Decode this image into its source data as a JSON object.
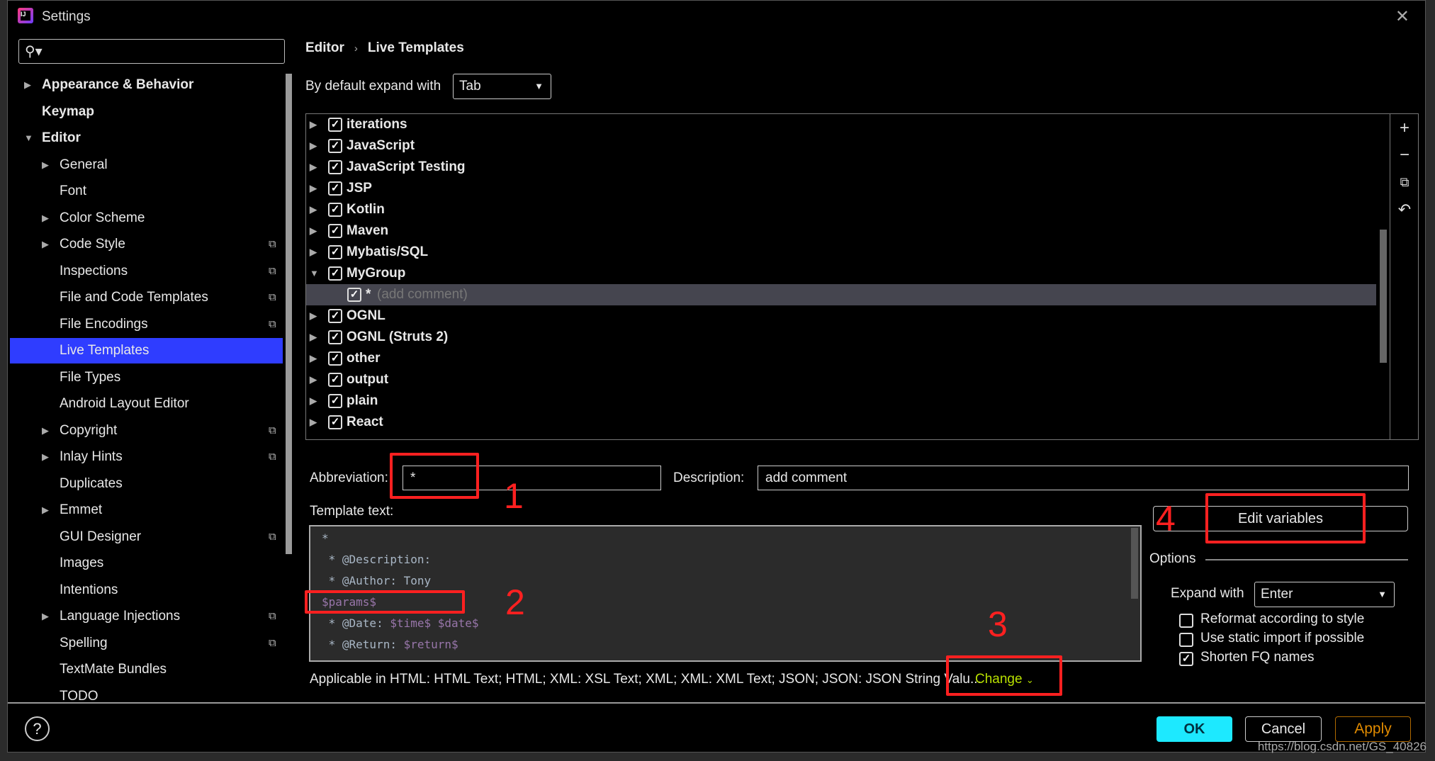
{
  "window": {
    "title": "Settings",
    "close_icon": "close-icon"
  },
  "search": {
    "placeholder": "",
    "icon": "search-icon"
  },
  "sidebar": {
    "items": [
      {
        "label": "Appearance & Behavior",
        "level": 0,
        "arrow": "collapsed",
        "bold": true,
        "copy": false
      },
      {
        "label": "Keymap",
        "level": 0,
        "arrow": "none",
        "bold": true,
        "copy": false
      },
      {
        "label": "Editor",
        "level": 0,
        "arrow": "expanded",
        "bold": true,
        "copy": false
      },
      {
        "label": "General",
        "level": 1,
        "arrow": "collapsed",
        "copy": false
      },
      {
        "label": "Font",
        "level": 1,
        "arrow": "none",
        "copy": false
      },
      {
        "label": "Color Scheme",
        "level": 1,
        "arrow": "collapsed",
        "copy": false
      },
      {
        "label": "Code Style",
        "level": 1,
        "arrow": "collapsed",
        "copy": true
      },
      {
        "label": "Inspections",
        "level": 1,
        "arrow": "none",
        "copy": true
      },
      {
        "label": "File and Code Templates",
        "level": 1,
        "arrow": "none",
        "copy": true
      },
      {
        "label": "File Encodings",
        "level": 1,
        "arrow": "none",
        "copy": true
      },
      {
        "label": "Live Templates",
        "level": 1,
        "arrow": "none",
        "copy": false,
        "selected": true
      },
      {
        "label": "File Types",
        "level": 1,
        "arrow": "none",
        "copy": false
      },
      {
        "label": "Android Layout Editor",
        "level": 1,
        "arrow": "none",
        "copy": false
      },
      {
        "label": "Copyright",
        "level": 1,
        "arrow": "collapsed",
        "copy": true
      },
      {
        "label": "Inlay Hints",
        "level": 1,
        "arrow": "collapsed",
        "copy": true
      },
      {
        "label": "Duplicates",
        "level": 1,
        "arrow": "none",
        "copy": false
      },
      {
        "label": "Emmet",
        "level": 1,
        "arrow": "collapsed",
        "copy": false
      },
      {
        "label": "GUI Designer",
        "level": 1,
        "arrow": "none",
        "copy": true
      },
      {
        "label": "Images",
        "level": 1,
        "arrow": "none",
        "copy": false
      },
      {
        "label": "Intentions",
        "level": 1,
        "arrow": "none",
        "copy": false
      },
      {
        "label": "Language Injections",
        "level": 1,
        "arrow": "collapsed",
        "copy": true
      },
      {
        "label": "Spelling",
        "level": 1,
        "arrow": "none",
        "copy": true
      },
      {
        "label": "TextMate Bundles",
        "level": 1,
        "arrow": "none",
        "copy": false
      },
      {
        "label": "TODO",
        "level": 1,
        "arrow": "none",
        "copy": false
      }
    ]
  },
  "breadcrumb": [
    "Editor",
    "Live Templates"
  ],
  "default_expand": {
    "label": "By default expand with",
    "value": "Tab"
  },
  "tree": {
    "rows": [
      {
        "label": "iterations",
        "checked": true,
        "arrow": "collapsed"
      },
      {
        "label": "JavaScript",
        "checked": true,
        "arrow": "collapsed"
      },
      {
        "label": "JavaScript Testing",
        "checked": true,
        "arrow": "collapsed"
      },
      {
        "label": "JSP",
        "checked": true,
        "arrow": "collapsed"
      },
      {
        "label": "Kotlin",
        "checked": true,
        "arrow": "collapsed"
      },
      {
        "label": "Maven",
        "checked": true,
        "arrow": "collapsed"
      },
      {
        "label": "Mybatis/SQL",
        "checked": true,
        "arrow": "collapsed"
      },
      {
        "label": "MyGroup",
        "checked": true,
        "arrow": "expanded"
      },
      {
        "label": "*",
        "hint": "(add comment)",
        "checked": true,
        "child": true,
        "selected": true
      },
      {
        "label": "OGNL",
        "checked": true,
        "arrow": "collapsed"
      },
      {
        "label": "OGNL (Struts 2)",
        "checked": true,
        "arrow": "collapsed"
      },
      {
        "label": "other",
        "checked": true,
        "arrow": "collapsed"
      },
      {
        "label": "output",
        "checked": true,
        "arrow": "collapsed"
      },
      {
        "label": "plain",
        "checked": true,
        "arrow": "collapsed"
      },
      {
        "label": "React",
        "checked": true,
        "arrow": "collapsed"
      }
    ],
    "tools": [
      "add-icon",
      "remove-icon",
      "copy-icon",
      "revert-icon"
    ]
  },
  "abbreviation": {
    "label": "Abbreviation:",
    "value": "*"
  },
  "description": {
    "label": "Description:",
    "value": "add comment"
  },
  "template_text": {
    "label": "Template text:",
    "lines": [
      [
        {
          "t": "*"
        }
      ],
      [
        {
          "t": " * @Description:"
        }
      ],
      [
        {
          "t": " * @Author: Tony"
        }
      ],
      [
        {
          "t": "$params$",
          "v": true
        }
      ],
      [
        {
          "t": " * @Date: "
        },
        {
          "t": "$time$ $date$",
          "v": true
        }
      ],
      [
        {
          "t": " * @Return: "
        },
        {
          "t": "$return$",
          "v": true
        }
      ],
      [
        {
          "t": " */"
        }
      ]
    ]
  },
  "applicable": {
    "text": "Applicable in HTML: HTML Text; HTML; XML: XSL Text; XML; XML: XML Text; JSON; JSON: JSON String Valu...",
    "change": "Change"
  },
  "edit_variables": "Edit variables",
  "options": {
    "title": "Options",
    "expand_label": "Expand with",
    "expand_value": "Enter",
    "checks": [
      {
        "label": "Reformat according to style",
        "checked": false
      },
      {
        "label": "Use static import if possible",
        "checked": false
      },
      {
        "label": "Shorten FQ names",
        "checked": true
      }
    ]
  },
  "buttons": {
    "ok": "OK",
    "cancel": "Cancel",
    "apply": "Apply",
    "help": "?"
  },
  "annotations": [
    "1",
    "2",
    "3",
    "4"
  ],
  "watermark": "https://blog.csdn.net/GS_40826",
  "colors": {
    "selection": "#2f3dff",
    "ok": "#1de9ff",
    "apply": "#e08a00",
    "change": "#b8e000",
    "annotation": "#ff2020"
  }
}
